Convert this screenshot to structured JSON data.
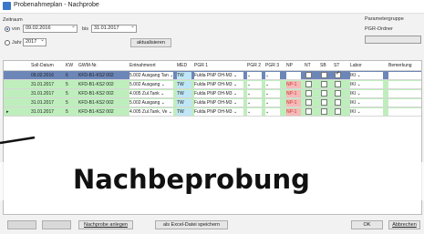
{
  "window": {
    "title": "Probenahmeplan - Nachprobe"
  },
  "zeitraum": {
    "label": "Zeitraum",
    "von_label": "von",
    "von_value": "09.02.2016",
    "bis_label": "bis",
    "bis_value": "31.01.2017",
    "jahr_label": "Jahr",
    "jahr_value": "2017",
    "refresh_label": "aktualisieren"
  },
  "parameter": {
    "label": "Parametergruppe",
    "ordner_label": "PGR-Ordner"
  },
  "grid": {
    "columns": [
      "Soll-Datum",
      "KW",
      "GWM-Nr.",
      "Entnahmeort",
      "MED",
      "PGR 1",
      "PGR 2",
      "PGR 3",
      "NP",
      "NT",
      "SB",
      "ST",
      "Labor",
      "Bemerkung"
    ],
    "rows": [
      {
        "date": "09.02.2016",
        "kw": "6",
        "gwm": "KFD-B1-KS2 002",
        "ort": "5.002 Ausgang Tan",
        "med": "TW",
        "pgr1": "Fulda PNP OH-M3",
        "np": "",
        "labor": "IKI",
        "nt": false,
        "sb": false,
        "st": true,
        "color": "#6d86b8"
      },
      {
        "date": "31.01.2017",
        "kw": "5",
        "gwm": "KFD-B1-KS2 002",
        "ort": "5.002 Ausgang",
        "med": "TW",
        "pgr1": "Fulda PNP OH-M3",
        "np": "NP-1",
        "labor": "IKI",
        "nt": false,
        "sb": false,
        "st": false,
        "color": "#bfeebd"
      },
      {
        "date": "31.01.2017",
        "kw": "5",
        "gwm": "KFD-B1-KS2 002",
        "ort": "4.005 Zul.Tank",
        "med": "TW",
        "pgr1": "Fulda PNP OH-M3",
        "np": "NP-1",
        "labor": "IKI",
        "nt": false,
        "sb": false,
        "st": false,
        "color": "#bfeebd"
      },
      {
        "date": "31.01.2017",
        "kw": "5",
        "gwm": "KFD-B1-KS2 002",
        "ort": "5.002 Ausgang",
        "med": "TW",
        "pgr1": "Fulda PNP OH-M3",
        "np": "NP-1",
        "labor": "IKI",
        "nt": false,
        "sb": false,
        "st": false,
        "color": "#bfeebd"
      },
      {
        "date": "31.01.2017",
        "kw": "5",
        "gwm": "KFD-B1-KS2 002",
        "ort": "4.005 Zul.Tank, Ve",
        "med": "TW",
        "pgr1": "Fulda PNP OH-M3",
        "np": "NP-1",
        "labor": "IKI",
        "nt": false,
        "sb": false,
        "st": false,
        "color": "#bfeebd"
      }
    ]
  },
  "overlay": {
    "text": "Nachbeprobung"
  },
  "buttons": {
    "nachprobe": "Nachprobe anlegen",
    "excel": "als Excel-Datei speichern",
    "ok": "OK",
    "abbrechen": "Abbrechen"
  },
  "colors": {
    "selected_row": "#6d86b8",
    "new_row": "#bfeebd",
    "np_badge": "#f6b8b8",
    "med_cell": "#bfe6f6"
  }
}
